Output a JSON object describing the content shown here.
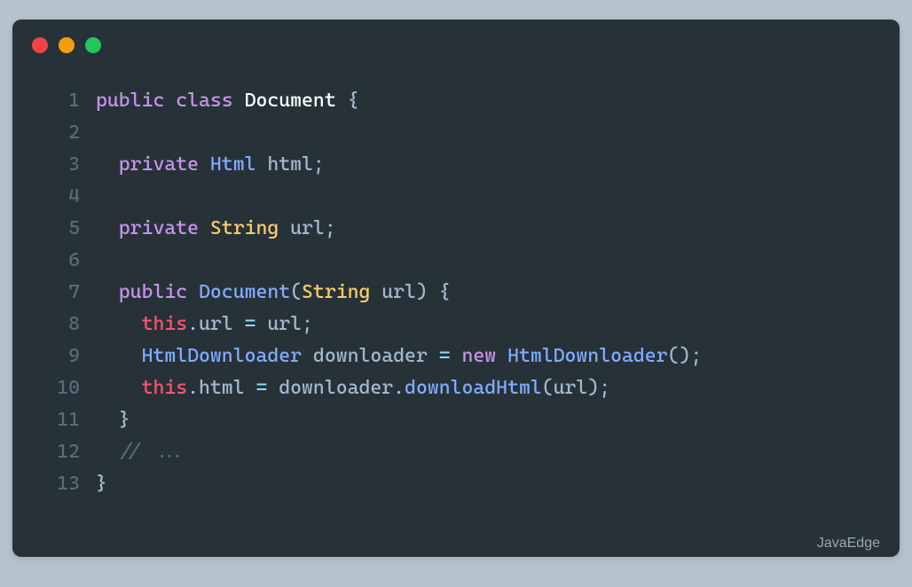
{
  "window": {
    "dots": [
      "red",
      "yellow",
      "green"
    ]
  },
  "code": {
    "lines": [
      {
        "n": "1",
        "tokens": [
          {
            "t": "public ",
            "c": "kw"
          },
          {
            "t": "class ",
            "c": "kw"
          },
          {
            "t": "Document",
            "c": "classname"
          },
          {
            "t": " {",
            "c": "brace"
          }
        ]
      },
      {
        "n": "2",
        "tokens": []
      },
      {
        "n": "3",
        "tokens": [
          {
            "t": "  ",
            "c": ""
          },
          {
            "t": "private ",
            "c": "kw"
          },
          {
            "t": "Html",
            "c": "type"
          },
          {
            "t": " html",
            "c": "param"
          },
          {
            "t": ";",
            "c": "punc"
          }
        ]
      },
      {
        "n": "4",
        "tokens": []
      },
      {
        "n": "5",
        "tokens": [
          {
            "t": "  ",
            "c": ""
          },
          {
            "t": "private ",
            "c": "kw"
          },
          {
            "t": "String",
            "c": "type2"
          },
          {
            "t": " url",
            "c": "param"
          },
          {
            "t": ";",
            "c": "punc"
          }
        ]
      },
      {
        "n": "6",
        "tokens": []
      },
      {
        "n": "7",
        "tokens": [
          {
            "t": "  ",
            "c": ""
          },
          {
            "t": "public ",
            "c": "kw"
          },
          {
            "t": "Document",
            "c": "type"
          },
          {
            "t": "(",
            "c": "punc"
          },
          {
            "t": "String",
            "c": "type2"
          },
          {
            "t": " url",
            "c": "param"
          },
          {
            "t": ")",
            "c": "punc"
          },
          {
            "t": " {",
            "c": "brace"
          }
        ]
      },
      {
        "n": "8",
        "tokens": [
          {
            "t": "    ",
            "c": ""
          },
          {
            "t": "this",
            "c": "this"
          },
          {
            "t": ".",
            "c": "op"
          },
          {
            "t": "url",
            "c": "param"
          },
          {
            "t": " = ",
            "c": "op"
          },
          {
            "t": "url",
            "c": "param"
          },
          {
            "t": ";",
            "c": "punc"
          }
        ]
      },
      {
        "n": "9",
        "tokens": [
          {
            "t": "    ",
            "c": ""
          },
          {
            "t": "HtmlDownloader",
            "c": "type"
          },
          {
            "t": " downloader",
            "c": "param"
          },
          {
            "t": " = ",
            "c": "op"
          },
          {
            "t": "new ",
            "c": "new"
          },
          {
            "t": "HtmlDownloader",
            "c": "type"
          },
          {
            "t": "(",
            "c": "punc"
          },
          {
            "t": ")",
            "c": "punc"
          },
          {
            "t": ";",
            "c": "punc"
          }
        ]
      },
      {
        "n": "10",
        "tokens": [
          {
            "t": "    ",
            "c": ""
          },
          {
            "t": "this",
            "c": "this"
          },
          {
            "t": ".",
            "c": "op"
          },
          {
            "t": "html",
            "c": "param"
          },
          {
            "t": " = ",
            "c": "op"
          },
          {
            "t": "downloader",
            "c": "param"
          },
          {
            "t": ".",
            "c": "op"
          },
          {
            "t": "downloadHtml",
            "c": "type"
          },
          {
            "t": "(",
            "c": "punc"
          },
          {
            "t": "url",
            "c": "param"
          },
          {
            "t": ")",
            "c": "punc"
          },
          {
            "t": ";",
            "c": "punc"
          }
        ]
      },
      {
        "n": "11",
        "tokens": [
          {
            "t": "  ",
            "c": ""
          },
          {
            "t": "}",
            "c": "brace"
          }
        ]
      },
      {
        "n": "12",
        "tokens": [
          {
            "t": "  ",
            "c": ""
          },
          {
            "t": "// ...",
            "c": "comment"
          }
        ]
      },
      {
        "n": "13",
        "tokens": [
          {
            "t": "}",
            "c": "brace"
          }
        ]
      }
    ]
  },
  "watermark": "JavaEdge"
}
